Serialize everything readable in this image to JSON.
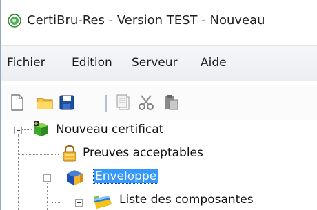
{
  "window": {
    "title": "CertiBru-Res - Version TEST - Nouveau",
    "icon": "globe-icon"
  },
  "menu": {
    "items": [
      {
        "label": "Fichier"
      },
      {
        "label": "Edition"
      },
      {
        "label": "Serveur"
      },
      {
        "label": "Aide"
      }
    ]
  },
  "toolbar": {
    "buttons": [
      "new-document-icon",
      "open-folder-icon",
      "save-icon",
      "copy-icon",
      "cut-icon",
      "paste-icon"
    ]
  },
  "tree": {
    "root": {
      "label": "Nouveau certificat",
      "icon": "certificate-cube-icon",
      "expanded": true
    },
    "nodes": [
      {
        "label": "Preuves acceptables",
        "icon": "lock-icon"
      },
      {
        "label": "Enveloppe",
        "icon": "envelope-building-icon",
        "expanded": true,
        "selected": true
      },
      {
        "label": "Liste des composantes",
        "icon": "list-components-icon",
        "expanded": true
      }
    ]
  },
  "colors": {
    "selection": "#3399ff",
    "menubar": "#eceef2"
  }
}
